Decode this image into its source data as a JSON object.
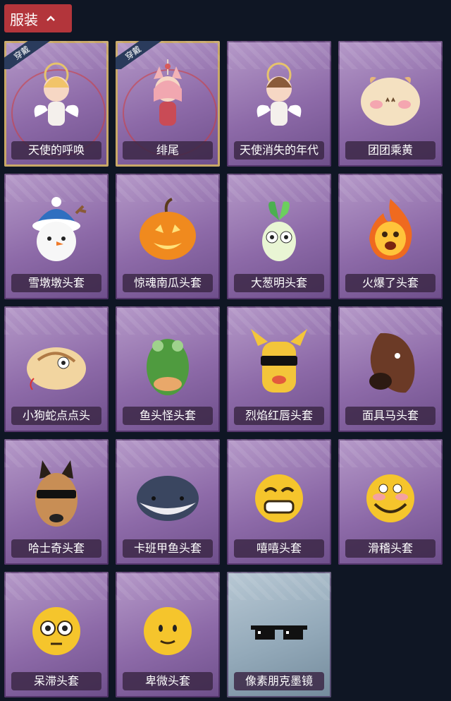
{
  "header": {
    "title": "服装",
    "chevron_icon": "chevron-up-icon",
    "bg_color": "#b3353b"
  },
  "badge_text": "穿戴",
  "items": [
    {
      "label": "天使的呼唤",
      "worn": true,
      "icon": "angel-figure-icon"
    },
    {
      "label": "绯尾",
      "worn": true,
      "icon": "fox-girl-figure-icon"
    },
    {
      "label": "天使消失的年代",
      "worn": false,
      "icon": "angel-girl-figure-icon"
    },
    {
      "label": "团团乘黄",
      "worn": false,
      "icon": "plush-creature-icon"
    },
    {
      "label": "雪墩墩头套",
      "worn": false,
      "icon": "snowman-head-icon"
    },
    {
      "label": "惊魂南瓜头套",
      "worn": false,
      "icon": "pumpkin-head-icon"
    },
    {
      "label": "大葱明头套",
      "worn": false,
      "icon": "scallion-head-icon"
    },
    {
      "label": "火爆了头套",
      "worn": false,
      "icon": "fire-head-icon"
    },
    {
      "label": "小狗蛇点点头",
      "worn": false,
      "icon": "snake-head-icon"
    },
    {
      "label": "鱼头怪头套",
      "worn": false,
      "icon": "fish-head-icon"
    },
    {
      "label": "烈焰红唇头套",
      "worn": false,
      "icon": "pikachu-head-icon"
    },
    {
      "label": "面具马头套",
      "worn": false,
      "icon": "horse-head-icon"
    },
    {
      "label": "哈士奇头套",
      "worn": false,
      "icon": "husky-head-icon"
    },
    {
      "label": "卡班甲鱼头套",
      "worn": false,
      "icon": "fish-blob-head-icon"
    },
    {
      "label": "嘻嘻头套",
      "worn": false,
      "icon": "grin-emoji-icon"
    },
    {
      "label": "滑稽头套",
      "worn": false,
      "icon": "funny-emoji-icon"
    },
    {
      "label": "呆滞头套",
      "worn": false,
      "icon": "stare-emoji-icon"
    },
    {
      "label": "卑微头套",
      "worn": false,
      "icon": "humble-emoji-icon"
    },
    {
      "label": "像素朋克墨镜",
      "worn": false,
      "icon": "pixel-sunglasses-icon",
      "special": true
    }
  ]
}
